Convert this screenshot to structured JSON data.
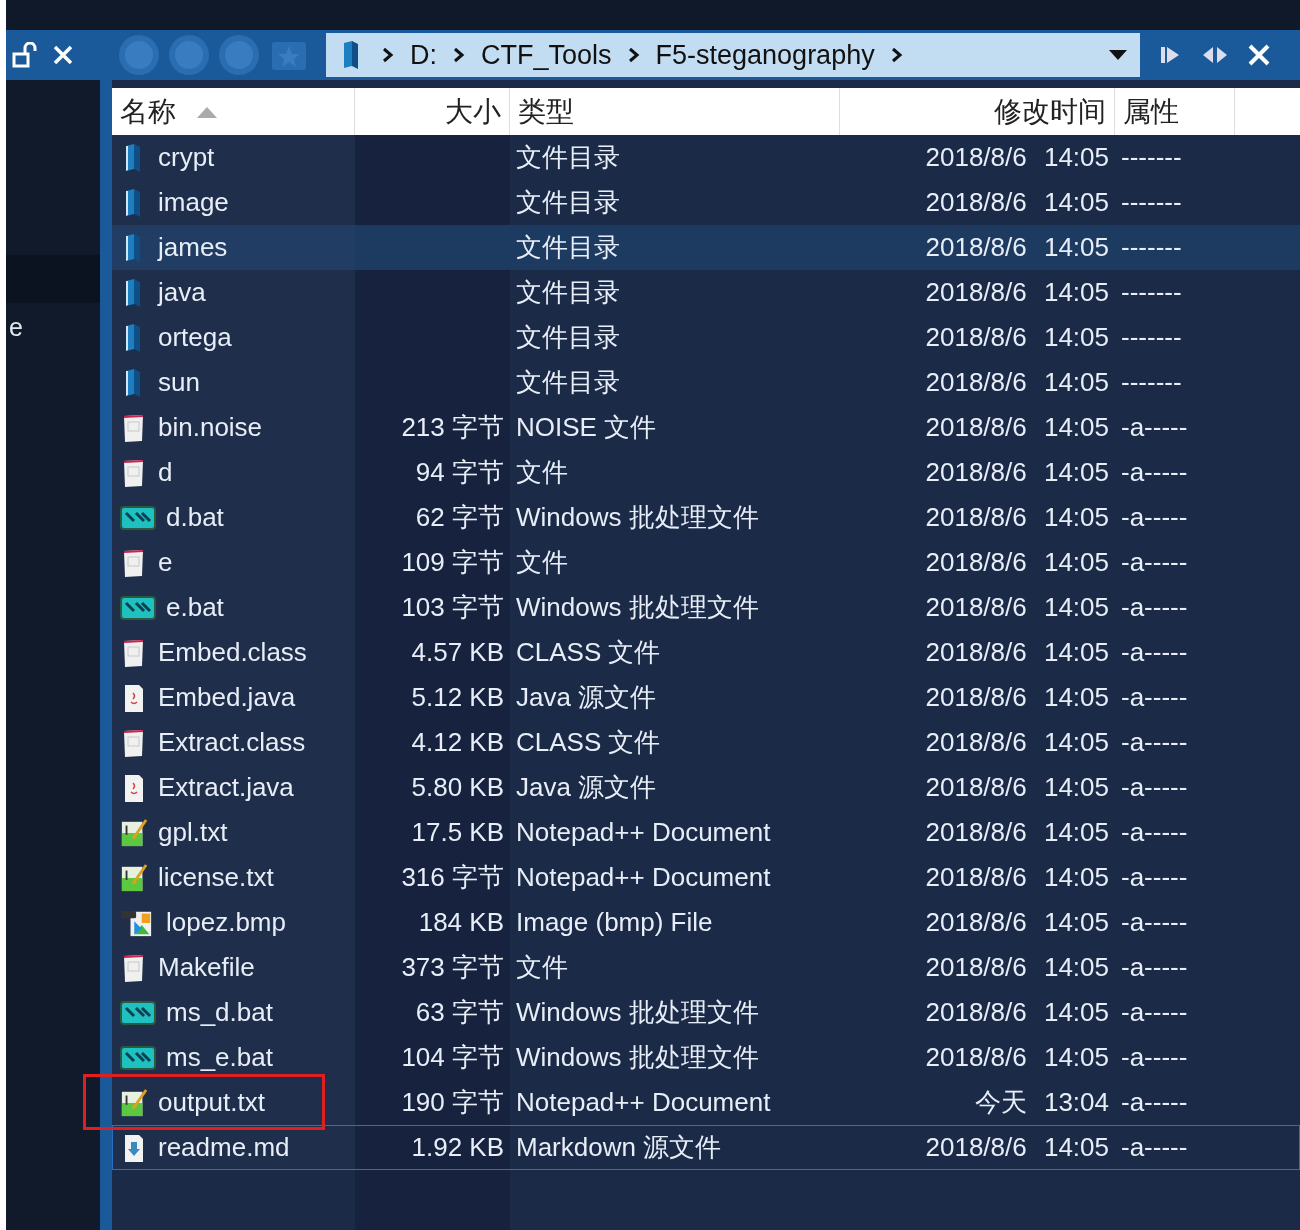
{
  "sidebar": {
    "items": [
      {
        "label": "e"
      }
    ]
  },
  "breadcrumb": {
    "segments": [
      "D:",
      "CTF_Tools",
      "F5-steganography"
    ]
  },
  "table": {
    "columns": [
      {
        "label": "名称",
        "sorted": true
      },
      {
        "label": "大小",
        "sorted": false
      },
      {
        "label": "类型",
        "sorted": false
      },
      {
        "label": "修改时间",
        "sorted": false
      },
      {
        "label": "属性",
        "sorted": false
      }
    ],
    "rows": [
      {
        "kind": "folder",
        "name": "crypt",
        "size": "",
        "type": "文件目录",
        "modified": "2018/8/6 14:05",
        "attributes": "-------",
        "selected": false,
        "focused": false,
        "annotated": false
      },
      {
        "kind": "folder",
        "name": "image",
        "size": "",
        "type": "文件目录",
        "modified": "2018/8/6 14:05",
        "attributes": "-------",
        "selected": false,
        "focused": false,
        "annotated": false
      },
      {
        "kind": "folder",
        "name": "james",
        "size": "",
        "type": "文件目录",
        "modified": "2018/8/6 14:05",
        "attributes": "-------",
        "selected": true,
        "focused": false,
        "annotated": false
      },
      {
        "kind": "folder",
        "name": "java",
        "size": "",
        "type": "文件目录",
        "modified": "2018/8/6 14:05",
        "attributes": "-------",
        "selected": false,
        "focused": false,
        "annotated": false
      },
      {
        "kind": "folder",
        "name": "ortega",
        "size": "",
        "type": "文件目录",
        "modified": "2018/8/6 14:05",
        "attributes": "-------",
        "selected": false,
        "focused": false,
        "annotated": false
      },
      {
        "kind": "folder",
        "name": "sun",
        "size": "",
        "type": "文件目录",
        "modified": "2018/8/6 14:05",
        "attributes": "-------",
        "selected": false,
        "focused": false,
        "annotated": false
      },
      {
        "kind": "file",
        "name": "bin.noise",
        "size": "213 字节",
        "type": "NOISE 文件",
        "modified": "2018/8/6 14:05",
        "attributes": "-a-----",
        "selected": false,
        "focused": false,
        "annotated": false
      },
      {
        "kind": "file",
        "name": "d",
        "size": "94 字节",
        "type": "文件",
        "modified": "2018/8/6 14:05",
        "attributes": "-a-----",
        "selected": false,
        "focused": false,
        "annotated": false
      },
      {
        "kind": "batch",
        "name": "d.bat",
        "size": "62 字节",
        "type": "Windows 批处理文件",
        "modified": "2018/8/6 14:05",
        "attributes": "-a-----",
        "selected": false,
        "focused": false,
        "annotated": false
      },
      {
        "kind": "file",
        "name": "e",
        "size": "109 字节",
        "type": "文件",
        "modified": "2018/8/6 14:05",
        "attributes": "-a-----",
        "selected": false,
        "focused": false,
        "annotated": false
      },
      {
        "kind": "batch",
        "name": "e.bat",
        "size": "103 字节",
        "type": "Windows 批处理文件",
        "modified": "2018/8/6 14:05",
        "attributes": "-a-----",
        "selected": false,
        "focused": false,
        "annotated": false
      },
      {
        "kind": "file",
        "name": "Embed.class",
        "size": "4.57 KB",
        "type": "CLASS 文件",
        "modified": "2018/8/6 14:05",
        "attributes": "-a-----",
        "selected": false,
        "focused": false,
        "annotated": false
      },
      {
        "kind": "java",
        "name": "Embed.java",
        "size": "5.12 KB",
        "type": "Java 源文件",
        "modified": "2018/8/6 14:05",
        "attributes": "-a-----",
        "selected": false,
        "focused": false,
        "annotated": false
      },
      {
        "kind": "file",
        "name": "Extract.class",
        "size": "4.12 KB",
        "type": "CLASS 文件",
        "modified": "2018/8/6 14:05",
        "attributes": "-a-----",
        "selected": false,
        "focused": false,
        "annotated": false
      },
      {
        "kind": "java",
        "name": "Extract.java",
        "size": "5.80 KB",
        "type": "Java 源文件",
        "modified": "2018/8/6 14:05",
        "attributes": "-a-----",
        "selected": false,
        "focused": false,
        "annotated": false
      },
      {
        "kind": "text",
        "name": "gpl.txt",
        "size": "17.5 KB",
        "type": "Notepad++ Document",
        "modified": "2018/8/6 14:05",
        "attributes": "-a-----",
        "selected": false,
        "focused": false,
        "annotated": false
      },
      {
        "kind": "text",
        "name": "license.txt",
        "size": "316 字节",
        "type": "Notepad++ Document",
        "modified": "2018/8/6 14:05",
        "attributes": "-a-----",
        "selected": false,
        "focused": false,
        "annotated": false
      },
      {
        "kind": "bitmap",
        "name": "lopez.bmp",
        "size": "184 KB",
        "type": "Image (bmp) File",
        "modified": "2018/8/6 14:05",
        "attributes": "-a-----",
        "selected": false,
        "focused": false,
        "annotated": false
      },
      {
        "kind": "file",
        "name": "Makefile",
        "size": "373 字节",
        "type": "文件",
        "modified": "2018/8/6 14:05",
        "attributes": "-a-----",
        "selected": false,
        "focused": false,
        "annotated": false
      },
      {
        "kind": "batch",
        "name": "ms_d.bat",
        "size": "63 字节",
        "type": "Windows 批处理文件",
        "modified": "2018/8/6 14:05",
        "attributes": "-a-----",
        "selected": false,
        "focused": false,
        "annotated": false
      },
      {
        "kind": "batch",
        "name": "ms_e.bat",
        "size": "104 字节",
        "type": "Windows 批处理文件",
        "modified": "2018/8/6 14:05",
        "attributes": "-a-----",
        "selected": false,
        "focused": false,
        "annotated": false
      },
      {
        "kind": "text",
        "name": "output.txt",
        "size": "190 字节",
        "type": "Notepad++ Document",
        "modified": "今天 13:04",
        "attributes": "-a-----",
        "selected": false,
        "focused": false,
        "annotated": true
      },
      {
        "kind": "markdown",
        "name": "readme.md",
        "size": "1.92 KB",
        "type": "Markdown 源文件",
        "modified": "2018/8/6 14:05",
        "attributes": "-a-----",
        "selected": false,
        "focused": true,
        "annotated": false
      }
    ]
  }
}
